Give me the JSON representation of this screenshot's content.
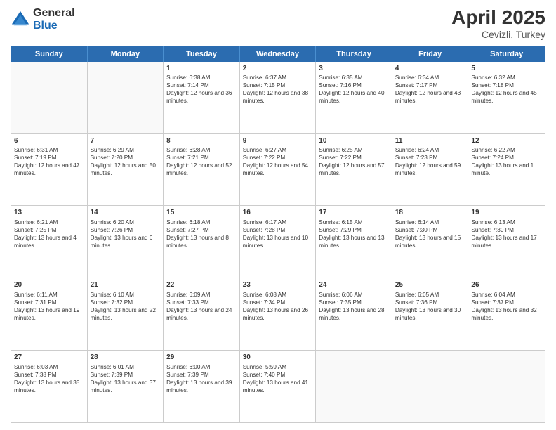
{
  "header": {
    "logo_general": "General",
    "logo_blue": "Blue",
    "title": "April 2025",
    "location": "Cevizli, Turkey"
  },
  "days_of_week": [
    "Sunday",
    "Monday",
    "Tuesday",
    "Wednesday",
    "Thursday",
    "Friday",
    "Saturday"
  ],
  "weeks": [
    [
      {
        "day": "",
        "sunrise": "",
        "sunset": "",
        "daylight": ""
      },
      {
        "day": "",
        "sunrise": "",
        "sunset": "",
        "daylight": ""
      },
      {
        "day": "1",
        "sunrise": "Sunrise: 6:38 AM",
        "sunset": "Sunset: 7:14 PM",
        "daylight": "Daylight: 12 hours and 36 minutes."
      },
      {
        "day": "2",
        "sunrise": "Sunrise: 6:37 AM",
        "sunset": "Sunset: 7:15 PM",
        "daylight": "Daylight: 12 hours and 38 minutes."
      },
      {
        "day": "3",
        "sunrise": "Sunrise: 6:35 AM",
        "sunset": "Sunset: 7:16 PM",
        "daylight": "Daylight: 12 hours and 40 minutes."
      },
      {
        "day": "4",
        "sunrise": "Sunrise: 6:34 AM",
        "sunset": "Sunset: 7:17 PM",
        "daylight": "Daylight: 12 hours and 43 minutes."
      },
      {
        "day": "5",
        "sunrise": "Sunrise: 6:32 AM",
        "sunset": "Sunset: 7:18 PM",
        "daylight": "Daylight: 12 hours and 45 minutes."
      }
    ],
    [
      {
        "day": "6",
        "sunrise": "Sunrise: 6:31 AM",
        "sunset": "Sunset: 7:19 PM",
        "daylight": "Daylight: 12 hours and 47 minutes."
      },
      {
        "day": "7",
        "sunrise": "Sunrise: 6:29 AM",
        "sunset": "Sunset: 7:20 PM",
        "daylight": "Daylight: 12 hours and 50 minutes."
      },
      {
        "day": "8",
        "sunrise": "Sunrise: 6:28 AM",
        "sunset": "Sunset: 7:21 PM",
        "daylight": "Daylight: 12 hours and 52 minutes."
      },
      {
        "day": "9",
        "sunrise": "Sunrise: 6:27 AM",
        "sunset": "Sunset: 7:22 PM",
        "daylight": "Daylight: 12 hours and 54 minutes."
      },
      {
        "day": "10",
        "sunrise": "Sunrise: 6:25 AM",
        "sunset": "Sunset: 7:22 PM",
        "daylight": "Daylight: 12 hours and 57 minutes."
      },
      {
        "day": "11",
        "sunrise": "Sunrise: 6:24 AM",
        "sunset": "Sunset: 7:23 PM",
        "daylight": "Daylight: 12 hours and 59 minutes."
      },
      {
        "day": "12",
        "sunrise": "Sunrise: 6:22 AM",
        "sunset": "Sunset: 7:24 PM",
        "daylight": "Daylight: 13 hours and 1 minute."
      }
    ],
    [
      {
        "day": "13",
        "sunrise": "Sunrise: 6:21 AM",
        "sunset": "Sunset: 7:25 PM",
        "daylight": "Daylight: 13 hours and 4 minutes."
      },
      {
        "day": "14",
        "sunrise": "Sunrise: 6:20 AM",
        "sunset": "Sunset: 7:26 PM",
        "daylight": "Daylight: 13 hours and 6 minutes."
      },
      {
        "day": "15",
        "sunrise": "Sunrise: 6:18 AM",
        "sunset": "Sunset: 7:27 PM",
        "daylight": "Daylight: 13 hours and 8 minutes."
      },
      {
        "day": "16",
        "sunrise": "Sunrise: 6:17 AM",
        "sunset": "Sunset: 7:28 PM",
        "daylight": "Daylight: 13 hours and 10 minutes."
      },
      {
        "day": "17",
        "sunrise": "Sunrise: 6:15 AM",
        "sunset": "Sunset: 7:29 PM",
        "daylight": "Daylight: 13 hours and 13 minutes."
      },
      {
        "day": "18",
        "sunrise": "Sunrise: 6:14 AM",
        "sunset": "Sunset: 7:30 PM",
        "daylight": "Daylight: 13 hours and 15 minutes."
      },
      {
        "day": "19",
        "sunrise": "Sunrise: 6:13 AM",
        "sunset": "Sunset: 7:30 PM",
        "daylight": "Daylight: 13 hours and 17 minutes."
      }
    ],
    [
      {
        "day": "20",
        "sunrise": "Sunrise: 6:11 AM",
        "sunset": "Sunset: 7:31 PM",
        "daylight": "Daylight: 13 hours and 19 minutes."
      },
      {
        "day": "21",
        "sunrise": "Sunrise: 6:10 AM",
        "sunset": "Sunset: 7:32 PM",
        "daylight": "Daylight: 13 hours and 22 minutes."
      },
      {
        "day": "22",
        "sunrise": "Sunrise: 6:09 AM",
        "sunset": "Sunset: 7:33 PM",
        "daylight": "Daylight: 13 hours and 24 minutes."
      },
      {
        "day": "23",
        "sunrise": "Sunrise: 6:08 AM",
        "sunset": "Sunset: 7:34 PM",
        "daylight": "Daylight: 13 hours and 26 minutes."
      },
      {
        "day": "24",
        "sunrise": "Sunrise: 6:06 AM",
        "sunset": "Sunset: 7:35 PM",
        "daylight": "Daylight: 13 hours and 28 minutes."
      },
      {
        "day": "25",
        "sunrise": "Sunrise: 6:05 AM",
        "sunset": "Sunset: 7:36 PM",
        "daylight": "Daylight: 13 hours and 30 minutes."
      },
      {
        "day": "26",
        "sunrise": "Sunrise: 6:04 AM",
        "sunset": "Sunset: 7:37 PM",
        "daylight": "Daylight: 13 hours and 32 minutes."
      }
    ],
    [
      {
        "day": "27",
        "sunrise": "Sunrise: 6:03 AM",
        "sunset": "Sunset: 7:38 PM",
        "daylight": "Daylight: 13 hours and 35 minutes."
      },
      {
        "day": "28",
        "sunrise": "Sunrise: 6:01 AM",
        "sunset": "Sunset: 7:39 PM",
        "daylight": "Daylight: 13 hours and 37 minutes."
      },
      {
        "day": "29",
        "sunrise": "Sunrise: 6:00 AM",
        "sunset": "Sunset: 7:39 PM",
        "daylight": "Daylight: 13 hours and 39 minutes."
      },
      {
        "day": "30",
        "sunrise": "Sunrise: 5:59 AM",
        "sunset": "Sunset: 7:40 PM",
        "daylight": "Daylight: 13 hours and 41 minutes."
      },
      {
        "day": "",
        "sunrise": "",
        "sunset": "",
        "daylight": ""
      },
      {
        "day": "",
        "sunrise": "",
        "sunset": "",
        "daylight": ""
      },
      {
        "day": "",
        "sunrise": "",
        "sunset": "",
        "daylight": ""
      }
    ]
  ]
}
